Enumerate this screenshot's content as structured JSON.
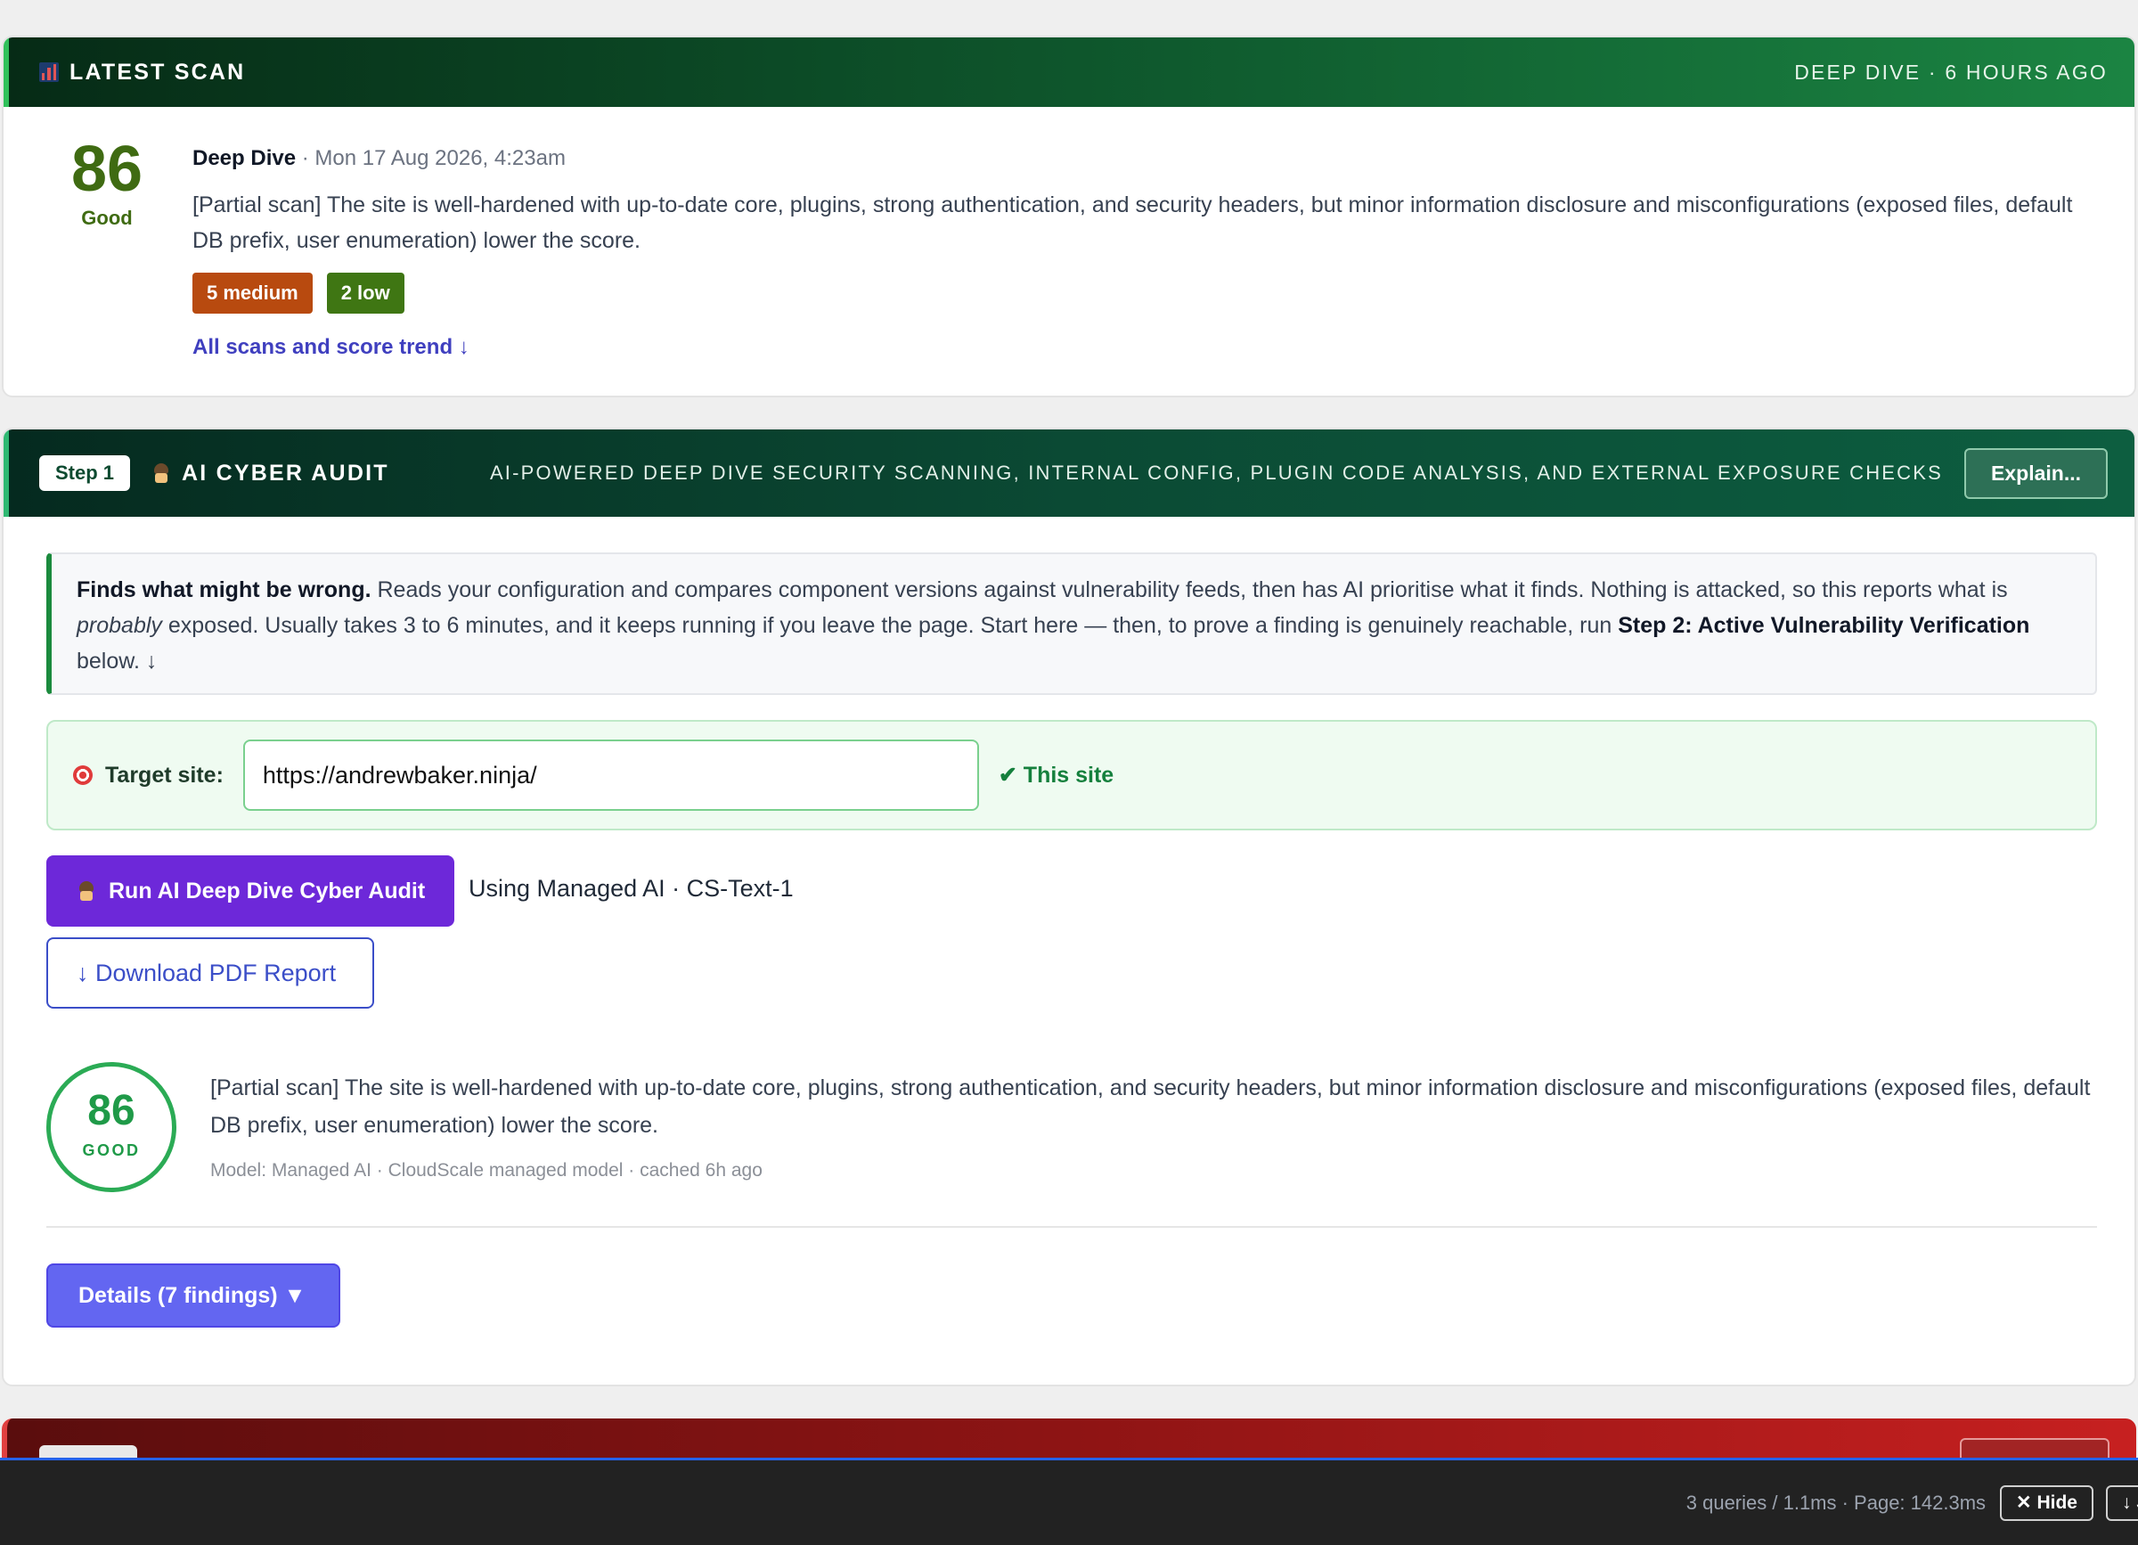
{
  "latest_scan": {
    "header_title": "LATEST SCAN",
    "header_right": "DEEP DIVE · 6 HOURS AGO",
    "score": "86",
    "grade": "Good",
    "scan_type": "Deep Dive",
    "scan_date": " · Mon 17 Aug 2026, 4:23am",
    "summary": "[Partial scan] The site is well-hardened with up-to-date core, plugins, strong authentication, and security headers, but minor information disclosure and misconfigurations (exposed files, default DB prefix, user enumeration) lower the score.",
    "badge_medium": "5 medium",
    "badge_low": "2 low",
    "trend_link": "All scans and score trend ↓"
  },
  "audit": {
    "step_label": "Step 1",
    "title": "AI CYBER AUDIT",
    "subtitle": "AI-POWERED DEEP DIVE SECURITY SCANNING, INTERNAL CONFIG, PLUGIN CODE ANALYSIS, AND EXTERNAL EXPOSURE CHECKS",
    "explain_label": "Explain...",
    "info": {
      "lead_bold": "Finds what might be wrong.",
      "text1": " Reads your configuration and compares component versions against vulnerability feeds, then has AI prioritise what it finds. Nothing is attacked, so this reports what is ",
      "italic": "probably",
      "text2": " exposed. Usually takes 3 to 6 minutes, and it keeps running if you leave the page. Start here — then, to prove a finding is genuinely reachable, run ",
      "step2_bold": "Step 2: Active Vulnerability Verification",
      "text3": " below. ↓"
    },
    "target_label": "Target site:",
    "target_value": "https://andrewbaker.ninja/",
    "this_site": "✔ This site",
    "run_button": "Run AI Deep Dive Cyber Audit",
    "using_text": "Using Managed AI · CS-Text-1",
    "pdf_button": "↓ Download PDF Report",
    "result_score": "86",
    "result_grade": "GOOD",
    "result_summary": "[Partial scan] The site is well-hardened with up-to-date core, plugins, strong authentication, and security headers, but minor information disclosure and misconfigurations (exposed files, default DB prefix, user enumeration) lower the score.",
    "model_line": "Model: Managed AI · CloudScale managed model · cached 6h ago",
    "details_button": "Details (7 findings) ▼"
  },
  "debug_bar": {
    "stats": "3 queries / 1.1ms · Page: 142.3ms",
    "hide_button": "✕ Hide",
    "jump_button": "↓ J"
  },
  "colors": {
    "good_green": "#1f9a48",
    "score_olive": "#3f6b12",
    "medium_orange": "#b84a0f",
    "low_green": "#3f7613",
    "run_purple": "#6d28d9",
    "details_indigo": "#6366f1",
    "link_blue": "#3f3fbf"
  },
  "icons": {
    "latest_scan": "bar-chart-icon",
    "audit": "ninja-icon",
    "target": "target-icon"
  }
}
